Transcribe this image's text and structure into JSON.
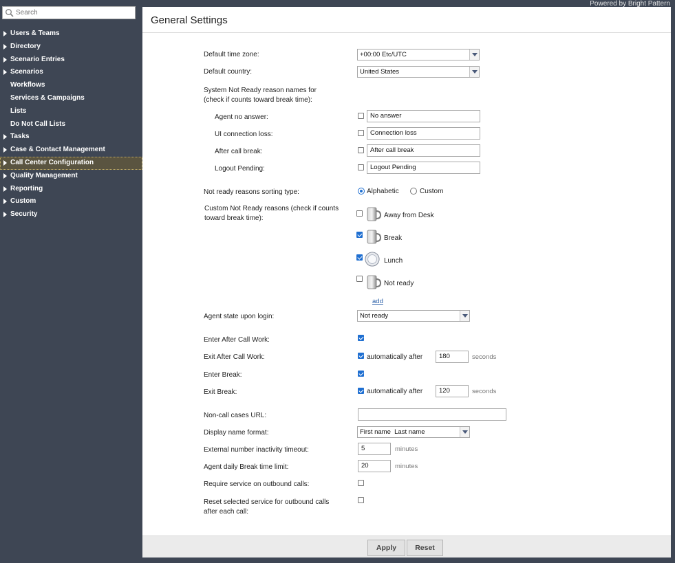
{
  "powered_by": "Powered by Bright Pattern",
  "search": {
    "placeholder": "Search"
  },
  "nav": [
    {
      "label": "Users & Teams",
      "expandable": true
    },
    {
      "label": "Directory",
      "expandable": true
    },
    {
      "label": "Scenario Entries",
      "expandable": true
    },
    {
      "label": "Scenarios",
      "expandable": true
    },
    {
      "label": "Workflows",
      "expandable": false
    },
    {
      "label": "Services & Campaigns",
      "expandable": false
    },
    {
      "label": "Lists",
      "expandable": false
    },
    {
      "label": "Do Not Call Lists",
      "expandable": false
    },
    {
      "label": "Tasks",
      "expandable": true
    },
    {
      "label": "Case & Contact Management",
      "expandable": true
    },
    {
      "label": "Call Center Configuration",
      "expandable": true,
      "active": true
    },
    {
      "label": "Quality Management",
      "expandable": true
    },
    {
      "label": "Reporting",
      "expandable": true
    },
    {
      "label": "Custom",
      "expandable": true
    },
    {
      "label": "Security",
      "expandable": true
    }
  ],
  "page_title": "General Settings",
  "form": {
    "default_time_zone": {
      "label": "Default time zone:",
      "value": "+00:00 Etc/UTC"
    },
    "default_country": {
      "label": "Default country:",
      "value": "United States"
    },
    "system_nr_header_1": "System Not Ready reason names for",
    "system_nr_header_2": "(check if counts toward break time):",
    "system_nr": [
      {
        "label": "Agent no answer:",
        "value": "No answer",
        "checked": false
      },
      {
        "label": "UI connection loss:",
        "value": "Connection loss",
        "checked": false
      },
      {
        "label": "After call break:",
        "value": "After call break",
        "checked": false
      },
      {
        "label": "Logout Pending:",
        "value": "Logout Pending",
        "checked": false
      }
    ],
    "sorting": {
      "label": "Not ready reasons sorting type:",
      "opt1": "Alphabetic",
      "opt2": "Custom",
      "selected": "Alphabetic"
    },
    "custom_nr_header_1": "Custom Not Ready reasons (check if counts",
    "custom_nr_header_2": "toward break time):",
    "custom_nr": [
      {
        "label": "Away from Desk",
        "checked": false,
        "icon": "mug-icon"
      },
      {
        "label": "Break",
        "checked": true,
        "icon": "mug-icon"
      },
      {
        "label": "Lunch",
        "checked": true,
        "icon": "plate-icon"
      },
      {
        "label": "Not ready",
        "checked": false,
        "icon": "mug-icon"
      }
    ],
    "add_link": "add",
    "agent_state": {
      "label": "Agent state upon login:",
      "value": "Not ready"
    },
    "enter_acw": {
      "label": "Enter After Call Work:",
      "checked": true
    },
    "exit_acw": {
      "label": "Exit After Call Work:",
      "checked": true,
      "text": "automatically after",
      "value": "180",
      "unit": "seconds"
    },
    "enter_break": {
      "label": "Enter Break:",
      "checked": true
    },
    "exit_break": {
      "label": "Exit Break:",
      "checked": true,
      "text": "automatically after",
      "value": "120",
      "unit": "seconds"
    },
    "non_call_url": {
      "label": "Non-call cases URL:",
      "value": ""
    },
    "display_name": {
      "label": "Display name format:",
      "value": "First name  Last name"
    },
    "ext_timeout": {
      "label": "External number inactivity timeout:",
      "value": "5",
      "unit": "minutes"
    },
    "break_limit": {
      "label": "Agent daily Break time limit:",
      "value": "20",
      "unit": "minutes"
    },
    "require_service": {
      "label": "Require service on outbound calls:",
      "checked": false
    },
    "reset_service": {
      "label_1": "Reset selected service for outbound calls",
      "label_2": "after each call:",
      "checked": false
    }
  },
  "buttons": {
    "apply": "Apply",
    "reset": "Reset"
  }
}
